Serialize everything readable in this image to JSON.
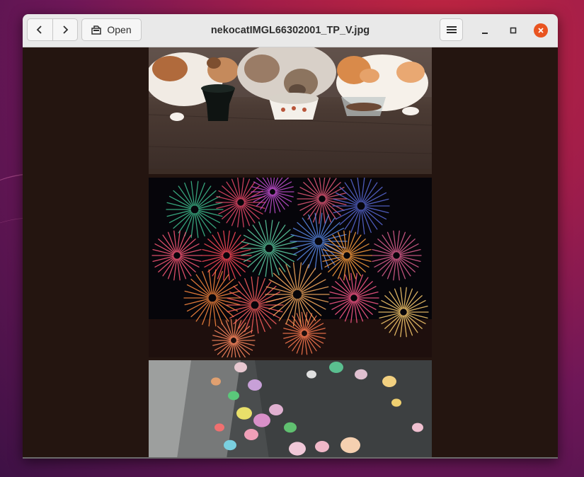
{
  "window": {
    "title": "nekocatIMGL66302001_TP_V.jpg"
  },
  "toolbar": {
    "open_label": "Open",
    "back_icon": "chevron-left-icon",
    "forward_icon": "chevron-right-icon",
    "open_icon": "folder-open-icon",
    "menu_icon": "hamburger-menu-icon"
  },
  "window_controls": {
    "close_color": "#e95420"
  },
  "photos": [
    {
      "subject": "cats"
    },
    {
      "subject": "fireworks"
    },
    {
      "subject": "climbing-wall"
    }
  ]
}
